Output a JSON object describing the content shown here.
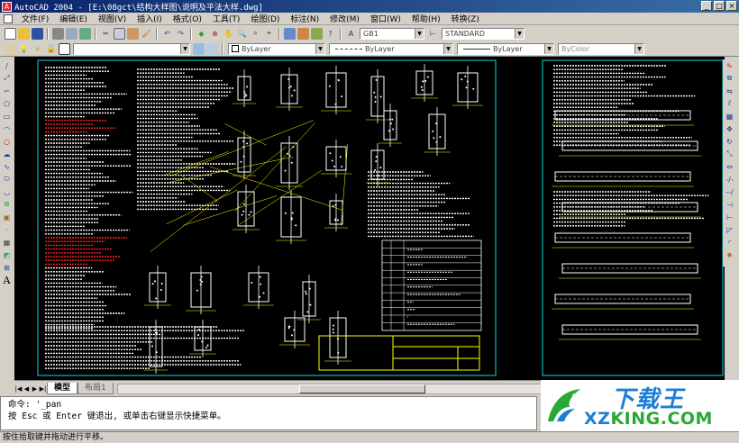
{
  "window": {
    "title": "AutoCAD 2004 - [E:\\08gct\\结构大样图\\说明及平法大样.dwg]",
    "minimize": "_",
    "maximize": "□",
    "close": "×"
  },
  "menu": {
    "items": [
      "文件(F)",
      "编辑(E)",
      "视图(V)",
      "插入(I)",
      "格式(O)",
      "工具(T)",
      "绘图(D)",
      "标注(N)",
      "修改(M)",
      "窗口(W)",
      "帮助(H)",
      "转换(Z)"
    ]
  },
  "toolbar_styles": {
    "text_style": "GB1",
    "dim_style": "STANDARD"
  },
  "toolbar_properties": {
    "layer": "ByLayer",
    "linetype1": "ByLayer",
    "linetype2": "ByLayer",
    "color": "ByColor"
  },
  "left_toolbar": {
    "text_tool": "A"
  },
  "tabs": {
    "model": "模型",
    "layout": "布局1"
  },
  "command": {
    "line1": "命令: '_pan",
    "line2": "按 Esc 或 Enter 键退出, 或单击右键显示快捷菜单。"
  },
  "status": {
    "text": "按住拾取键并拖动进行平移。"
  },
  "watermark": {
    "top": "下载王",
    "bottom_left": "XZ",
    "bottom_right": "KING.COM"
  },
  "colors": {
    "canvas": "#000000",
    "drawing_white": "#ffffff",
    "drawing_yellow": "#ffff00",
    "drawing_red": "#ff2020",
    "frame_cyan": "#00ffff"
  }
}
